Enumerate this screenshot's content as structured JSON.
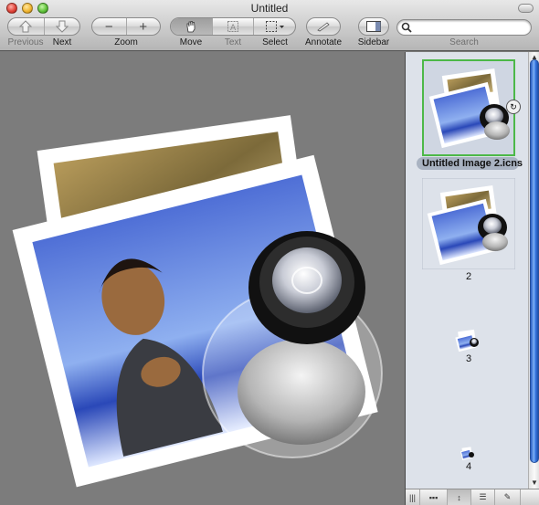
{
  "window": {
    "title": "Untitled"
  },
  "toolbar": {
    "previous_label": "Previous",
    "next_label": "Next",
    "zoom_label": "Zoom",
    "move_label": "Move",
    "text_label": "Text",
    "select_label": "Select",
    "annotate_label": "Annotate",
    "sidebar_label": "Sidebar",
    "search_label": "Search",
    "search_value": ""
  },
  "sidebar": {
    "items": [
      {
        "label": "Untitled Image 2.icns",
        "selected": true
      },
      {
        "label": "2",
        "selected": false
      },
      {
        "label": "3",
        "selected": false
      },
      {
        "label": "4",
        "selected": false
      }
    ]
  },
  "icons": [
    "previous-arrow-icon",
    "next-arrow-icon",
    "zoom-out-icon",
    "zoom-in-icon",
    "hand-icon",
    "text-tool-icon",
    "select-tool-icon",
    "annotate-pencil-icon",
    "sidebar-icon",
    "search-icon",
    "preview-app-icon"
  ],
  "colors": {
    "selection_border": "#4cb848",
    "scroll_thumb": "#3d7ce4",
    "canvas_bg": "#7c7c7c"
  }
}
